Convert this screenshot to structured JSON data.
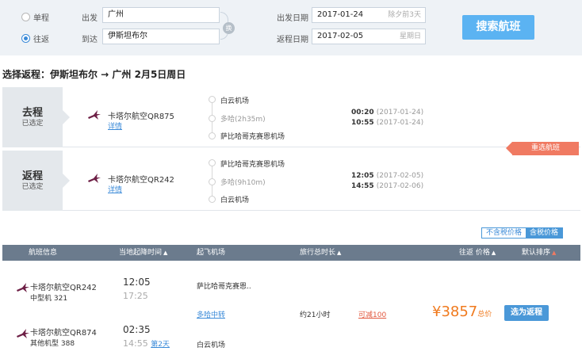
{
  "search": {
    "trip_type": [
      {
        "label": "单程",
        "checked": false
      },
      {
        "label": "往返",
        "checked": true
      }
    ],
    "from_label": "出发",
    "from_value": "广州",
    "to_label": "到达",
    "to_value": "伊斯坦布尔",
    "swap_label": "换",
    "depart_date_label": "出发日期",
    "depart_date_value": "2017-01-24",
    "depart_date_hint": "除夕前3天",
    "return_date_label": "返程日期",
    "return_date_value": "2017-02-05",
    "return_date_hint": "星期日",
    "search_button": "搜索航班"
  },
  "heading": "选择返程：伊斯坦布尔 → 广州  2月5日周日",
  "selected_trips": [
    {
      "tag": "去程",
      "tag_sub": "已选定",
      "airline": "卡塔尔航空QR875",
      "detail_link": "详情",
      "from_airport": "白云机场",
      "stop": "多哈(2h35m)",
      "to_airport": "萨比哈哥克赛恩机场",
      "dep_time": "00:20",
      "dep_date": "(2017-01-24)",
      "arr_time": "10:55",
      "arr_date": "(2017-01-24)"
    },
    {
      "tag": "返程",
      "tag_sub": "已选定",
      "airline": "卡塔尔航空QR242",
      "detail_link": "详情",
      "from_airport": "萨比哈哥克赛恩机场",
      "stop": "多哈(9h10m)",
      "to_airport": "白云机场",
      "dep_time": "12:05",
      "dep_date": "(2017-02-05)",
      "arr_time": "14:55",
      "arr_date": "(2017-02-06)"
    }
  ],
  "reselect_button": "重选航班",
  "price_toggle": {
    "exclude_tax": "不含税价格",
    "include_tax": "含税价格",
    "active": "include_tax"
  },
  "table": {
    "headers": {
      "flight_info": "航班信息",
      "local_time": "当地起降时间",
      "airports": "起飞机场",
      "duration": "旅行总时长",
      "price": "往返 价格",
      "default_sort": "默认排序"
    },
    "rows": [
      {
        "airline": "卡塔尔航空QR242",
        "aircraft": "中型机 321",
        "dep_time": "12:05",
        "arr_time": "17:25",
        "airport": "萨比哈哥克赛恩..",
        "transfer": "多哈中转",
        "duration": "约21小时",
        "reduction": "可减100",
        "price": "¥3857",
        "price_unit": "总价",
        "select_button": "选为返程"
      },
      {
        "airline": "卡塔尔航空QR874",
        "aircraft": "其他机型 388",
        "dep_time": "02:35",
        "arr_time": "14:55",
        "next_day": "第2天",
        "airport": "白云机场"
      }
    ]
  },
  "colors": {
    "accent_blue": "#4a98d8",
    "search_button": "#5bb3f2",
    "price_orange": "#f07a1e",
    "reselect_red": "#f07a62"
  }
}
